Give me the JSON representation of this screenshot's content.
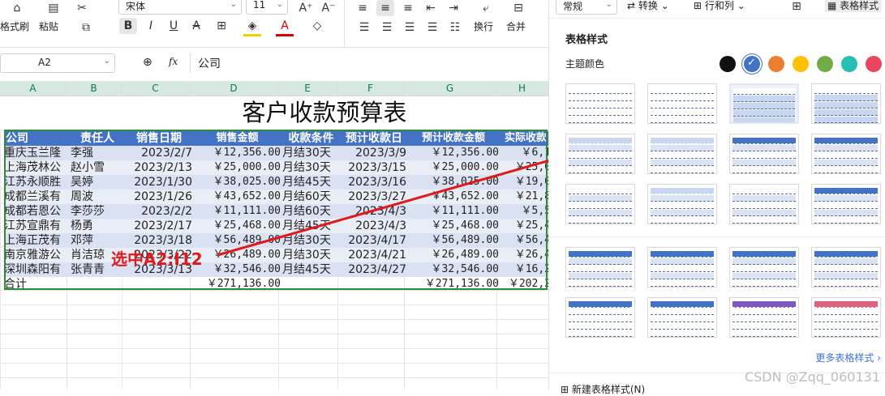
{
  "toolbar": {
    "format_painter": "格式刷",
    "paste": "粘贴",
    "font_name": "宋体",
    "font_size": "11",
    "wrap": "换行",
    "merge": "合并",
    "number_format": "常规",
    "convert": "转换",
    "row_col": "行和列",
    "table_style": "表格样式"
  },
  "formula_bar": {
    "cell_ref": "A2",
    "fx": "fx",
    "value": "公司"
  },
  "columns": [
    "A",
    "B",
    "C",
    "D",
    "E",
    "F",
    "G",
    "H"
  ],
  "sheet": {
    "title": "客户收款预算表",
    "headers": [
      "公司",
      "责任人",
      "销售日期",
      "销售金额",
      "收款条件",
      "预计收款日",
      "预计收款金额",
      "实际收款"
    ],
    "rows": [
      [
        "重庆玉兰隆",
        "李强",
        "2023/2/7",
        "￥12,356.00",
        "月结30天",
        "2023/3/9",
        "￥12,356.00",
        "￥6,1"
      ],
      [
        "上海茂林公",
        "赵小雪",
        "2023/2/13",
        "￥25,000.00",
        "月结30天",
        "2023/3/15",
        "￥25,000.00",
        "￥25,0"
      ],
      [
        "江苏永顺胜",
        "吴婷",
        "2023/1/30",
        "￥38,025.00",
        "月结45天",
        "2023/3/16",
        "￥38,025.00",
        "￥19,0"
      ],
      [
        "成都兰溪有",
        "周波",
        "2023/1/26",
        "￥43,652.00",
        "月结60天",
        "2023/3/27",
        "￥43,652.00",
        "￥21,8"
      ],
      [
        "成都若恩公",
        "李莎莎",
        "2023/2/2",
        "￥11,111.00",
        "月结60天",
        "2023/4/3",
        "￥11,111.00",
        "￥5,5"
      ],
      [
        "江苏宣鼎有",
        "杨勇",
        "2023/2/17",
        "￥25,468.00",
        "月结45天",
        "2023/4/3",
        "￥25,468.00",
        "￥25,4"
      ],
      [
        "上海正茂有",
        "邓萍",
        "2023/3/18",
        "￥56,489.00",
        "月结30天",
        "2023/4/17",
        "￥56,489.00",
        "￥56,4"
      ],
      [
        "南京雅游公",
        "肖洁琼",
        "2023/3/22",
        "￥26,489.00",
        "月结30天",
        "2023/4/21",
        "￥26,489.00",
        "￥26,4"
      ],
      [
        "深圳森阳有",
        "张青青",
        "2023/3/13",
        "￥32,546.00",
        "月结45天",
        "2023/4/27",
        "￥32,546.00",
        "￥16,2"
      ]
    ],
    "total": {
      "label": "合计",
      "sales": "￥271,136.00",
      "expected": "￥271,136.00",
      "actual": "￥202,2"
    }
  },
  "annotation": {
    "text": "选中A2:I12",
    "color": "#e0191b"
  },
  "panel": {
    "title": "表格样式",
    "theme_colors_label": "主题颜色",
    "theme_colors": [
      "#111111",
      "#4472c4",
      "#ed7d31",
      "#ffc000",
      "#70ad47",
      "#26bfb3",
      "#e8475f"
    ],
    "selected_color": "#4472c4",
    "more_styles": "更多表格样式",
    "new_style": "新建表格样式(N)"
  },
  "watermark": "CSDN @Zqq_060131",
  "colors": {
    "header_blue": "#4472c4",
    "band_blue": "#d9e1f2",
    "selection_green": "#2e8b3a"
  }
}
